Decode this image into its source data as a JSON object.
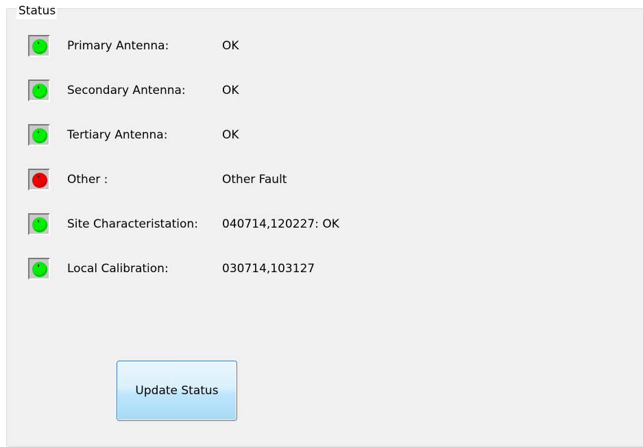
{
  "status_group": {
    "title": "Status",
    "rows": [
      {
        "label": "Primary Antenna:",
        "value": "OK",
        "indicator": "green",
        "indicator_color": "#00ee00"
      },
      {
        "label": "Secondary Antenna:",
        "value": "OK",
        "indicator": "green",
        "indicator_color": "#00ee00"
      },
      {
        "label": "Tertiary Antenna:",
        "value": "OK",
        "indicator": "green",
        "indicator_color": "#00ee00"
      },
      {
        "label": "Other :",
        "value": "Other Fault",
        "indicator": "red",
        "indicator_color": "#ee0000"
      },
      {
        "label": "Site Characteristation:",
        "value": "040714,120227: OK",
        "indicator": "green",
        "indicator_color": "#00ee00"
      },
      {
        "label": "Local Calibration:",
        "value": "030714,103127",
        "indicator": "green",
        "indicator_color": "#00ee00"
      }
    ]
  },
  "update_button": {
    "label": "Update Status"
  }
}
